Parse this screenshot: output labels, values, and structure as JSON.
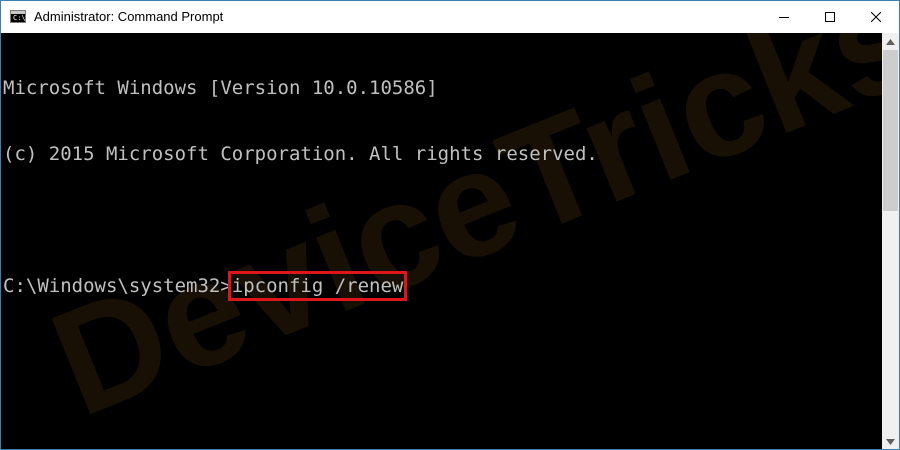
{
  "window": {
    "title": "Administrator: Command Prompt",
    "icon": "cmd-app-icon",
    "icon_glyph": "C:\\",
    "controls": [
      "minimize-icon",
      "maximize-icon",
      "close-icon"
    ]
  },
  "console": {
    "lines": [
      "Microsoft Windows [Version 10.0.10586]",
      "(c) 2015 Microsoft Corporation. All rights reserved.",
      ""
    ],
    "prompt": "C:\\Windows\\system32>",
    "command": "ipconfig /renew",
    "text_color": "#c0c0c0",
    "highlight_color": "#e0141b"
  },
  "watermark": {
    "text": "DeviceTricks"
  },
  "scrollbar": {
    "up_icon": "scroll-up-arrow-icon",
    "down_icon": "scroll-down-arrow-icon"
  }
}
